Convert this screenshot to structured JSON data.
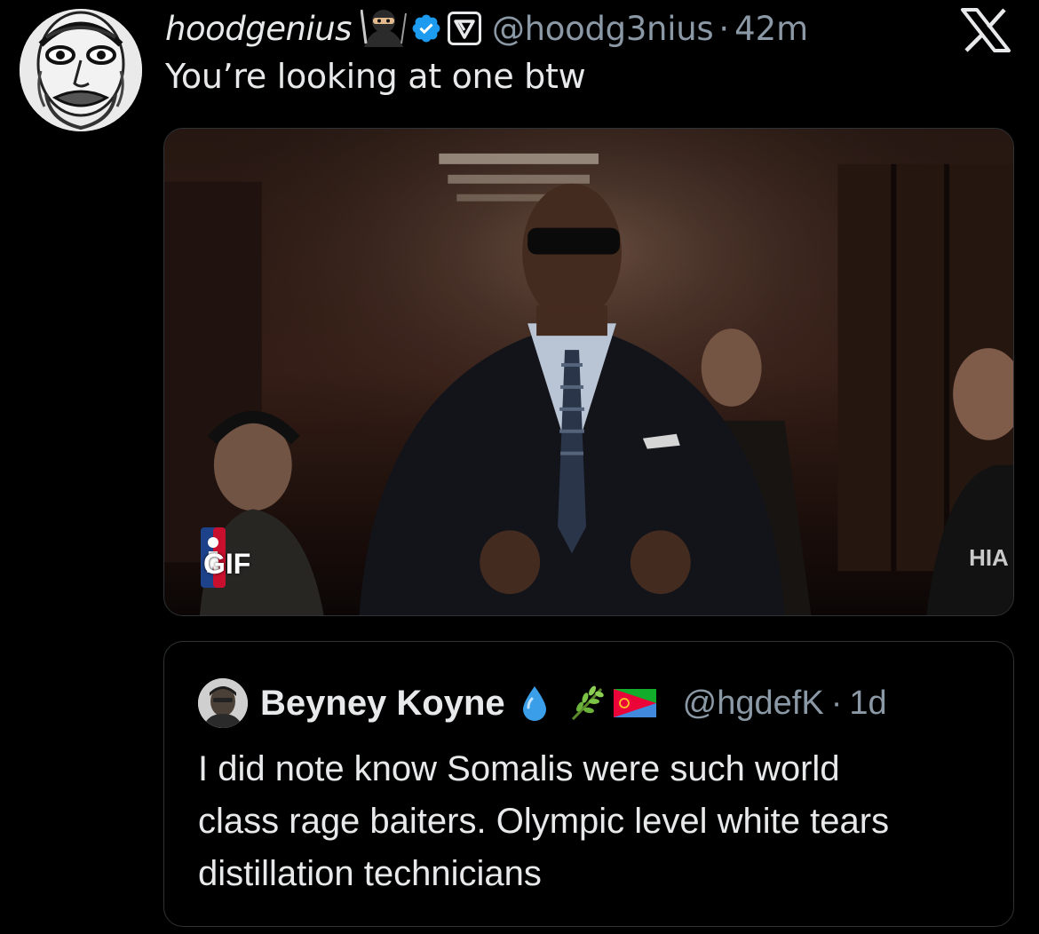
{
  "tweet": {
    "display_name": "hoodgenius",
    "name_emoji": "ninja",
    "verified": true,
    "handle": "@hoodg3nius",
    "separator": "·",
    "time": "42m",
    "text": "You’re looking at one btw",
    "media": {
      "badge": "GIF",
      "jersey_text": "HIA"
    }
  },
  "platform_logo": "X",
  "quote": {
    "display_name": "Beyney Koyne",
    "emojis": [
      "droplet",
      "herb",
      "eritrea-flag"
    ],
    "handle": "@hgdefK",
    "separator": "·",
    "time": "1d",
    "text_lines": [
      "I did note know Somalis were such world",
      "class rage baiters. Olympic level white tears",
      "distillation technicians"
    ]
  },
  "colors": {
    "background": "#000000",
    "primary_text": "#e7e9ea",
    "secondary_text": "#8b98a5",
    "border": "#2f3336",
    "verified_blue": "#1d9bf0"
  }
}
